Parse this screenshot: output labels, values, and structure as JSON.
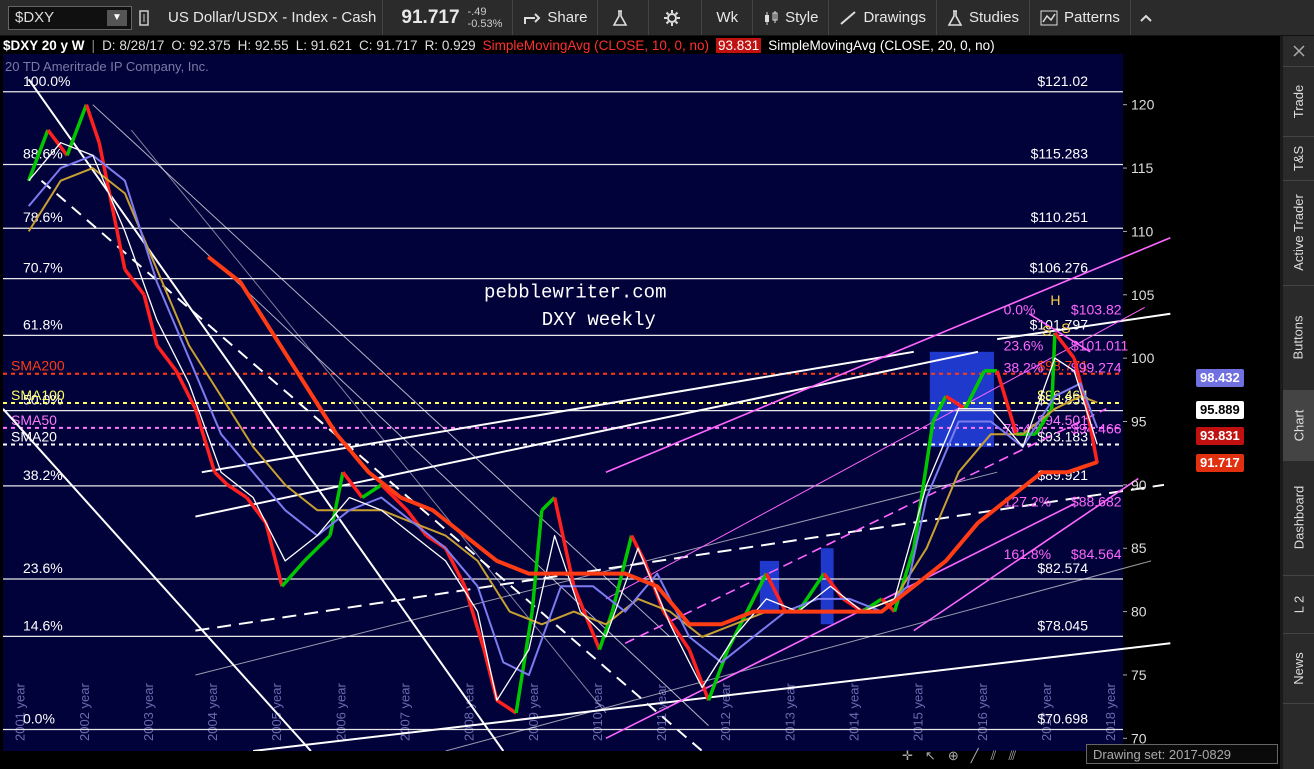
{
  "toolbar": {
    "symbol": "$DXY",
    "description": "US Dollar/USDX - Index - Cash",
    "last": "91.717",
    "change": "-.49",
    "change_pct": "-0.53%",
    "share": "Share",
    "aggregation": "Wk",
    "style": "Style",
    "drawings": "Drawings",
    "studies": "Studies",
    "patterns": "Patterns"
  },
  "infobar": {
    "title": "$DXY 20 y W",
    "date": "D: 8/28/17",
    "open": "O: 92.375",
    "high": "H: 92.55",
    "low": "L: 91.621",
    "close": "C: 91.717",
    "range": "R: 0.929",
    "sma10_label": "SimpleMovingAvg (CLOSE, 10, 0, no)",
    "sma10_value": "93.831",
    "sma20_label": "SimpleMovingAvg (CLOSE, 20, 0, no)"
  },
  "watermark": "20 TD Ameritrade IP Company, Inc.",
  "annotation": {
    "line1": "pebblewriter.com",
    "line2": "DXY weekly"
  },
  "sidebar_tabs": [
    "Trade",
    "T&S",
    "Active Trader",
    "Buttons",
    "Chart",
    "Dashboard",
    "L 2",
    "News"
  ],
  "active_tab": "Chart",
  "drawing_set": "Drawing set: 2017-0829",
  "colors": {
    "price_up": "#00c800",
    "price_down": "#ff2020",
    "sma200": "#ff3c14",
    "sma100": "#c8a032",
    "sma50": "#7c7cf0",
    "sma20": "#ffffff",
    "fib_pink": "#ff66ff",
    "background": "#02023a"
  },
  "chart_data": {
    "type": "line",
    "title": "$DXY 20 y W",
    "x_range": [
      2000.6,
      2019.2
    ],
    "y_range": [
      69,
      124
    ],
    "x_ticks": [
      "02",
      "03",
      "04",
      "05",
      "06",
      "07",
      "08",
      "09",
      "10",
      "11",
      "12",
      "13",
      "14",
      "15",
      "16",
      "17",
      "18",
      "19"
    ],
    "y_ticks": [
      70,
      75,
      80,
      85,
      90,
      95,
      100,
      105,
      110,
      115,
      120
    ],
    "year_labels": [
      "2001 year",
      "2002 year",
      "2003 year",
      "2004 year",
      "2005 year",
      "2006 year",
      "2007 year",
      "2008 year",
      "2009 year",
      "2010 year",
      "2011 year",
      "2012 year",
      "2013 year",
      "2014 year",
      "2015 year",
      "2016 year",
      "2017 year",
      "2018 year"
    ],
    "fib_levels_left": [
      {
        "label": "100.0%",
        "value": 121.02
      },
      {
        "label": "88.6%",
        "value": 115.283
      },
      {
        "label": "78.6%",
        "value": 110.251
      },
      {
        "label": "70.7%",
        "value": 106.276
      },
      {
        "label": "61.8%",
        "value": 101.797
      },
      {
        "label": "50.0%",
        "value": 95.859
      },
      {
        "label": "38.2%",
        "value": 89.921
      },
      {
        "label": "23.6%",
        "value": 82.574
      },
      {
        "label": "14.6%",
        "value": 78.045
      },
      {
        "label": "0.0%",
        "value": 70.698
      }
    ],
    "fib_value_labels": [
      "$121.02",
      "$115.283",
      "$110.251",
      "$106.276",
      "$101.797",
      "$95.859",
      "$89.921",
      "$82.574",
      "$78.045",
      "$70.698"
    ],
    "moving_averages": [
      {
        "name": "SMA200",
        "value": 98.771,
        "label": "$98.771",
        "color": "#ff3c14"
      },
      {
        "name": "SMA100",
        "value": 96.464,
        "label": "$96.464",
        "color": "#ffff66"
      },
      {
        "name": "SMA50",
        "value": 94.501,
        "label": "$94.501",
        "color": "#ff77ff"
      },
      {
        "name": "SMA20",
        "value": 93.183,
        "label": "$93.183",
        "color": "#ffffff"
      }
    ],
    "pink_fibs": [
      {
        "label": "0.0%",
        "value_label": "$103.82",
        "value": 103.82
      },
      {
        "label": "23.6%",
        "value_label": "$101.011",
        "value": 101.011
      },
      {
        "label": "38.2%",
        "value_label": "$99.274",
        "value": 99.274
      },
      {
        "label": "76.4%",
        "value_label": "$94.466",
        "value": 94.466
      },
      {
        "label": "127.2%",
        "value_label": "$88.682",
        "value": 88.682
      },
      {
        "label": "161.8%",
        "value_label": "$84.564",
        "value": 84.564
      }
    ],
    "hs_labels": [
      "S",
      "H",
      "S"
    ],
    "price_labels": [
      {
        "text": "98.432",
        "value": 98.432,
        "bg": "#7070e0",
        "fg": "#ffffff"
      },
      {
        "text": "95.889",
        "value": 95.889,
        "bg": "#ffffff",
        "fg": "#000000"
      },
      {
        "text": "93.831",
        "value": 93.831,
        "bg": "#c01010",
        "fg": "#ffffff"
      },
      {
        "text": "91.717",
        "value": 91.717,
        "bg": "#e03010",
        "fg": "#ffffff"
      }
    ],
    "price": {
      "x": [
        2001.0,
        2001.3,
        2001.6,
        2001.9,
        2002.1,
        2002.3,
        2002.5,
        2002.8,
        2003.0,
        2003.3,
        2003.6,
        2003.9,
        2004.1,
        2004.4,
        2004.7,
        2004.95,
        2005.3,
        2005.7,
        2005.9,
        2006.2,
        2006.5,
        2006.9,
        2007.2,
        2007.5,
        2007.8,
        2008.1,
        2008.3,
        2008.6,
        2008.85,
        2009.0,
        2009.2,
        2009.5,
        2009.9,
        2010.1,
        2010.4,
        2010.6,
        2010.9,
        2011.3,
        2011.6,
        2011.9,
        2012.1,
        2012.5,
        2012.8,
        2013.0,
        2013.4,
        2013.7,
        2014.0,
        2014.3,
        2014.5,
        2014.8,
        2015.1,
        2015.3,
        2015.6,
        2015.9,
        2016.1,
        2016.4,
        2016.7,
        2016.95,
        2017.0,
        2017.3,
        2017.5,
        2017.66
      ],
      "y": [
        114,
        118,
        116,
        120,
        117,
        112,
        107,
        105,
        101,
        99,
        96,
        91,
        90,
        89,
        87,
        82,
        84,
        86,
        91,
        89,
        90,
        88,
        86,
        85,
        82,
        77,
        73,
        72,
        80,
        88,
        89,
        82,
        77,
        80,
        86,
        84,
        80,
        77,
        73,
        77,
        79,
        83,
        80,
        80,
        83,
        81,
        80,
        81,
        80,
        85,
        95,
        97,
        96,
        99,
        99,
        94,
        94,
        96,
        102,
        100,
        96,
        91.7
      ]
    },
    "sma20": {
      "x": [
        2001.0,
        2001.5,
        2002.0,
        2002.5,
        2003.0,
        2003.5,
        2004.0,
        2004.5,
        2005.0,
        2005.5,
        2006.0,
        2006.5,
        2007.0,
        2007.5,
        2008.0,
        2008.3,
        2008.8,
        2009.2,
        2009.6,
        2010.0,
        2010.5,
        2011.0,
        2011.5,
        2012.0,
        2012.5,
        2013.0,
        2013.5,
        2014.0,
        2014.5,
        2015.0,
        2015.5,
        2016.0,
        2016.5,
        2017.0,
        2017.3,
        2017.66
      ],
      "y": [
        114,
        117,
        116,
        110,
        103,
        98,
        91,
        89,
        84,
        86,
        89,
        88,
        86,
        84,
        80,
        73,
        77,
        86,
        80,
        78,
        85,
        79,
        74,
        78,
        81,
        80,
        82,
        80,
        81,
        90,
        96,
        96,
        93,
        100,
        99,
        93.2
      ]
    },
    "sma50": {
      "x": [
        2001.0,
        2001.5,
        2002.0,
        2002.5,
        2003.0,
        2003.5,
        2004.0,
        2004.5,
        2005.0,
        2005.5,
        2006.0,
        2006.5,
        2007.0,
        2007.5,
        2008.0,
        2008.4,
        2008.8,
        2009.3,
        2009.8,
        2010.3,
        2010.8,
        2011.3,
        2011.8,
        2012.3,
        2012.8,
        2013.3,
        2013.8,
        2014.3,
        2014.7,
        2015.0,
        2015.5,
        2016.0,
        2016.5,
        2017.0,
        2017.4,
        2017.66
      ],
      "y": [
        112,
        115,
        116,
        114,
        106,
        100,
        94,
        91,
        88,
        86,
        88,
        89,
        87,
        85,
        82,
        76,
        75,
        82,
        82,
        80,
        83,
        78,
        76,
        78,
        80,
        81,
        81,
        80,
        82,
        89,
        95,
        95,
        93,
        97,
        98,
        94.5
      ]
    },
    "sma100": {
      "x": [
        2001.0,
        2001.5,
        2002.0,
        2002.5,
        2003.0,
        2003.5,
        2004.0,
        2004.5,
        2005.0,
        2005.5,
        2006.0,
        2006.5,
        2007.0,
        2007.5,
        2008.0,
        2008.5,
        2009.0,
        2009.5,
        2010.0,
        2010.5,
        2011.0,
        2011.5,
        2012.0,
        2012.5,
        2013.0,
        2013.5,
        2014.0,
        2014.5,
        2015.0,
        2015.5,
        2016.0,
        2016.5,
        2017.0,
        2017.4,
        2017.66
      ],
      "y": [
        110,
        114,
        115,
        113,
        107,
        101,
        97,
        93,
        90,
        88,
        88,
        88,
        87,
        86,
        84,
        80,
        79,
        80,
        79,
        81,
        80,
        78,
        79,
        80,
        80,
        80,
        80,
        81,
        85,
        91,
        94,
        94,
        96,
        97,
        96.5
      ]
    },
    "sma200": {
      "x": [
        2003.8,
        2004.3,
        2004.8,
        2005.3,
        2005.8,
        2006.3,
        2006.8,
        2007.3,
        2007.8,
        2008.3,
        2008.8,
        2009.3,
        2009.8,
        2010.3,
        2010.8,
        2011.3,
        2011.8,
        2012.3,
        2012.8,
        2013.3,
        2013.8,
        2014.3,
        2014.8,
        2015.3,
        2015.8,
        2016.3,
        2016.8,
        2017.2,
        2017.66
      ],
      "y": [
        108,
        106,
        102,
        98,
        94,
        91,
        89,
        88,
        86,
        84,
        83,
        83,
        83,
        83,
        82,
        79,
        79,
        80,
        80,
        80,
        80,
        80,
        82,
        84,
        87,
        89,
        91,
        91,
        91.8
      ]
    },
    "blue_boxes": [
      {
        "x0": 2015.05,
        "x1": 2016.05,
        "y0": 93,
        "y1": 100.5
      },
      {
        "x0": 2012.4,
        "x1": 2012.7,
        "y0": 80,
        "y1": 84
      },
      {
        "x0": 2013.35,
        "x1": 2013.55,
        "y0": 79,
        "y1": 85
      }
    ]
  }
}
